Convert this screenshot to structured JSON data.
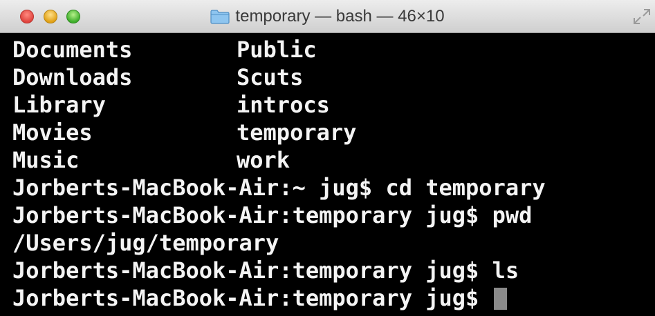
{
  "window": {
    "title": "temporary — bash — 46×10",
    "folder_icon": "folder-icon",
    "resize_icon": "fullscreen-icon"
  },
  "terminal": {
    "listing": [
      {
        "left": "Documents",
        "right": "Public"
      },
      {
        "left": "Downloads",
        "right": "Scuts"
      },
      {
        "left": "Library",
        "right": "introcs"
      },
      {
        "left": "Movies",
        "right": "temporary"
      },
      {
        "left": "Music",
        "right": "work"
      }
    ],
    "lines": [
      "Jorberts-MacBook-Air:~ jug$ cd temporary",
      "Jorberts-MacBook-Air:temporary jug$ pwd",
      "/Users/jug/temporary",
      "Jorberts-MacBook-Air:temporary jug$ ls",
      "Jorberts-MacBook-Air:temporary jug$ "
    ]
  },
  "colors": {
    "background": "#000000",
    "text": "#f4f4f4",
    "cursor": "#8a8a8a"
  }
}
